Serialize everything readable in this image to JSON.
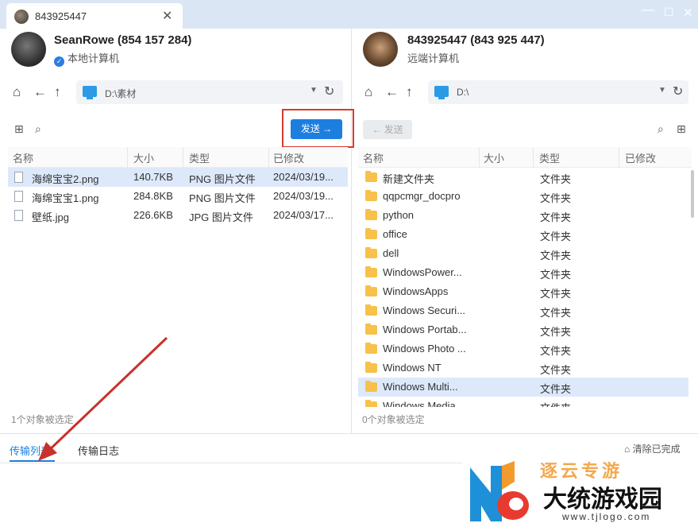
{
  "titlebar": {
    "tab_title": "843925447",
    "tab_close": "✕",
    "win_min": "—",
    "win_max": "☐",
    "win_close": "✕"
  },
  "local": {
    "name": "SeanRowe (854 157 284)",
    "subtitle": "本地计算机",
    "path": "D:\\素材"
  },
  "remote": {
    "name": "843925447 (843 925 447)",
    "subtitle": "远端计算机",
    "path": "D:\\"
  },
  "toolbar": {
    "send_label": "发送 →",
    "send_disabled_label": "← 发送"
  },
  "local_table": {
    "headers": [
      "名称",
      "大小",
      "类型",
      "已修改"
    ],
    "rows": [
      {
        "name": "海绵宝宝2.png",
        "size": "140.7KB",
        "type": "PNG 图片文件",
        "modified": "2024/03/19..."
      },
      {
        "name": "海绵宝宝1.png",
        "size": "284.8KB",
        "type": "PNG 图片文件",
        "modified": "2024/03/19..."
      },
      {
        "name": "壁纸.jpg",
        "size": "226.6KB",
        "type": "JPG 图片文件",
        "modified": "2024/03/17..."
      }
    ],
    "status": "1个对象被选定"
  },
  "remote_table": {
    "headers": [
      "名称",
      "大小",
      "类型",
      "已修改"
    ],
    "rows": [
      {
        "name": "新建文件夹",
        "type": "文件夹"
      },
      {
        "name": "qqpcmgr_docpro",
        "type": "文件夹"
      },
      {
        "name": "python",
        "type": "文件夹"
      },
      {
        "name": "office",
        "type": "文件夹"
      },
      {
        "name": "dell",
        "type": "文件夹"
      },
      {
        "name": "WindowsPower...",
        "type": "文件夹"
      },
      {
        "name": "WindowsApps",
        "type": "文件夹"
      },
      {
        "name": "Windows Securi...",
        "type": "文件夹"
      },
      {
        "name": "Windows Portab...",
        "type": "文件夹"
      },
      {
        "name": "Windows Photo ...",
        "type": "文件夹"
      },
      {
        "name": "Windows NT",
        "type": "文件夹"
      },
      {
        "name": "Windows Multi...",
        "type": "文件夹"
      },
      {
        "name": "Windows Media",
        "type": "文件夹"
      }
    ],
    "status": "0个对象被选定"
  },
  "bottom": {
    "tab_transfer_list": "传输列表",
    "tab_transfer_log": "传输日志",
    "clear_completed": "⌂ 清除已完成"
  },
  "watermark": {
    "top_text": "逐云专游",
    "main_text": "大统游戏园",
    "url": "www.tjlogo.com"
  },
  "colors": {
    "accent": "#1c7fe0",
    "highlight_red": "#d53b30",
    "selected_row": "#dde9fa",
    "folder": "#f7c14a"
  }
}
